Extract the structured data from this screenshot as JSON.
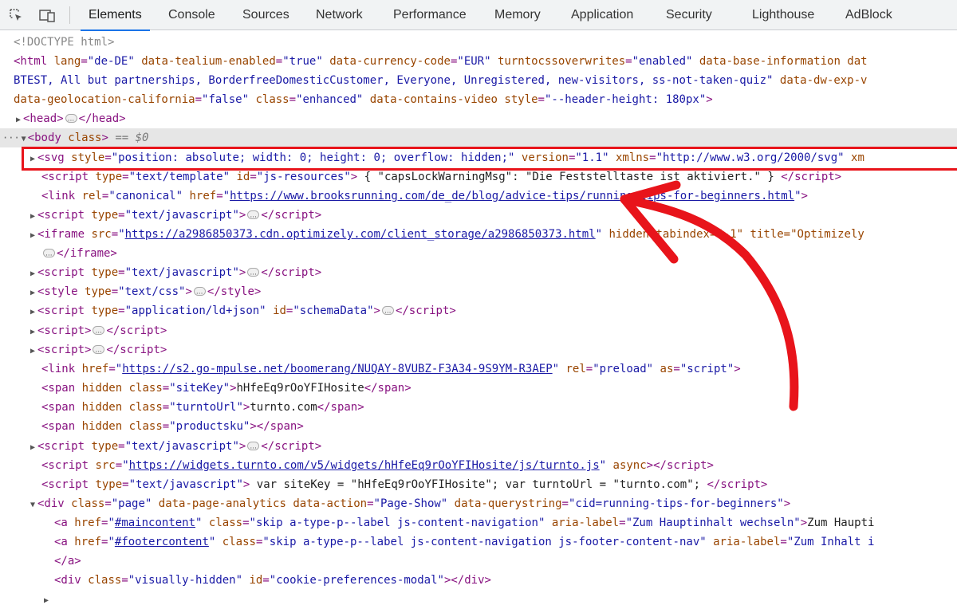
{
  "toolbar": {
    "inspect_icon": "inspect-element-icon",
    "device_icon": "device-toolbar-icon",
    "tabs": [
      {
        "label": "Elements",
        "active": true
      },
      {
        "label": "Console"
      },
      {
        "label": "Sources"
      },
      {
        "label": "Network"
      },
      {
        "label": "Performance"
      },
      {
        "label": "Memory"
      },
      {
        "label": "Application"
      },
      {
        "label": "Security"
      },
      {
        "label": "Lighthouse"
      },
      {
        "label": "AdBlock"
      }
    ]
  },
  "dom": {
    "doctype": "<!DOCTYPE html>",
    "html_line1": {
      "lang": "\"de-DE\"",
      "tealium": "\"true\"",
      "currency": "\"EUR\"",
      "turnto": "\"enabled\"",
      "base_info_name": "data-base-information dat"
    },
    "html_line2": {
      "segments": "BTEST, All but partnerships, BorderfreeDomesticCustomer, Everyone, Unregistered, new-visitors, ss-not-taken-quiz\"",
      "exp_name": "data-dw-exp-v"
    },
    "html_line3": {
      "geo_val": "\"false\"",
      "class_val": "\"enhanced\"",
      "style_val": "\"--header-height: 180px\""
    },
    "head": {
      "tag": "head"
    },
    "body": {
      "marker": "== $0"
    },
    "svg": {
      "style_val": "\"position: absolute; width: 0; height: 0; overflow: hidden;\"",
      "version_val": "\"1.1\"",
      "xmlns_val": "\"http://www.w3.org/2000/svg\"",
      "trail": "xm"
    },
    "resources": {
      "type_val": "\"text/template\"",
      "id_val": "\"js-resources\"",
      "content": " { \"capsLockWarningMsg\": \"Die Feststelltaste ist aktiviert.\" } "
    },
    "canonical": {
      "rel_val": "\"canonical\"",
      "href": "https://www.brooksrunning.com/de_de/blog/advice-tips/running-tips-for-beginners.html"
    },
    "js_type": "\"text/javascript\"",
    "iframe": {
      "src": "https://a2986850373.cdn.optimizely.com/client_storage/a2986850373.html",
      "after": " hidden tabindex=\"-1\" title=\"Optimizely"
    },
    "style_type": "\"text/css\"",
    "ldjson": {
      "type_val": "\"application/ld+json\"",
      "id_val": "\"schemaData\""
    },
    "mpulse": {
      "href": "https://s2.go-mpulse.net/boomerang/NUQAY-8VUBZ-F3A34-9S9YM-R3AEP",
      "rel_val": "\"preload\"",
      "as_val": "\"script\""
    },
    "sitekey": {
      "class_val": "\"siteKey\"",
      "text": "hHfeEq9rOoYFIHosite"
    },
    "turntourl": {
      "class_val": "\"turntoUrl\"",
      "text": "turnto.com"
    },
    "productsku": {
      "class_val": "\"productsku\""
    },
    "turnto_src": "https://widgets.turnto.com/v5/widgets/hHfeEq9rOoYFIHosite/js/turnto.js",
    "inline_script": " var siteKey = \"hHfeEq9rOoYFIHosite\"; var turntoUrl = \"turnto.com\"; ",
    "page_div": {
      "class_val": "\"page\"",
      "action_val": "\"Page-Show\"",
      "qs_val": "\"cid=running-tips-for-beginners\""
    },
    "skip1": {
      "href": "#maincontent",
      "class_val": "\"skip a-type-p--label js-content-navigation\"",
      "aria_val": "\"Zum Hauptinhalt wechseln\"",
      "text": "Zum Haupti"
    },
    "skip2": {
      "href": "#footercontent",
      "class_val": "\"skip a-type-p--label js-content-navigation js-footer-content-nav\"",
      "aria_val": "\"Zum Inhalt i"
    },
    "cookie_div": {
      "class_val": "\"visually-hidden\"",
      "id_val": "\"cookie-preferences-modal\""
    }
  },
  "annotation": {
    "color": "#e8141b"
  }
}
